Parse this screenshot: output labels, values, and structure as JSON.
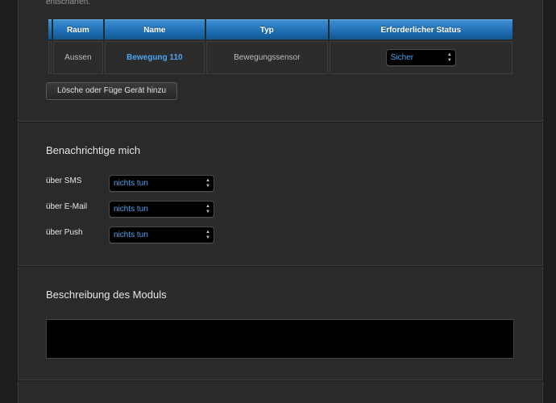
{
  "intro_text": "entschärfen.",
  "device_table": {
    "headers": [
      "Raum",
      "Name",
      "Typ",
      "Erforderlicher Status"
    ],
    "rows": [
      {
        "raum": "Aussen",
        "name": "Bewegung 110",
        "typ": "Bewegungssensor",
        "status": "Sicher"
      }
    ]
  },
  "manage_button_label": "Lösche oder Füge Gerät hinzu",
  "notify": {
    "heading": "Benachrichtige mich",
    "rows": [
      {
        "label": "über SMS",
        "value": "nichts tun"
      },
      {
        "label": "über E-Mail",
        "value": "nichts tun"
      },
      {
        "label": "über Push",
        "value": "nichts tun"
      }
    ]
  },
  "description": {
    "heading": "Beschreibung des Moduls",
    "value": ""
  },
  "icons": {
    "select_arrows": "up-down-arrows-icon"
  },
  "colors": {
    "header_blue": "#1f6fb5",
    "link_blue": "#4fa3f0",
    "panel_bg": "#2a2a2a"
  }
}
